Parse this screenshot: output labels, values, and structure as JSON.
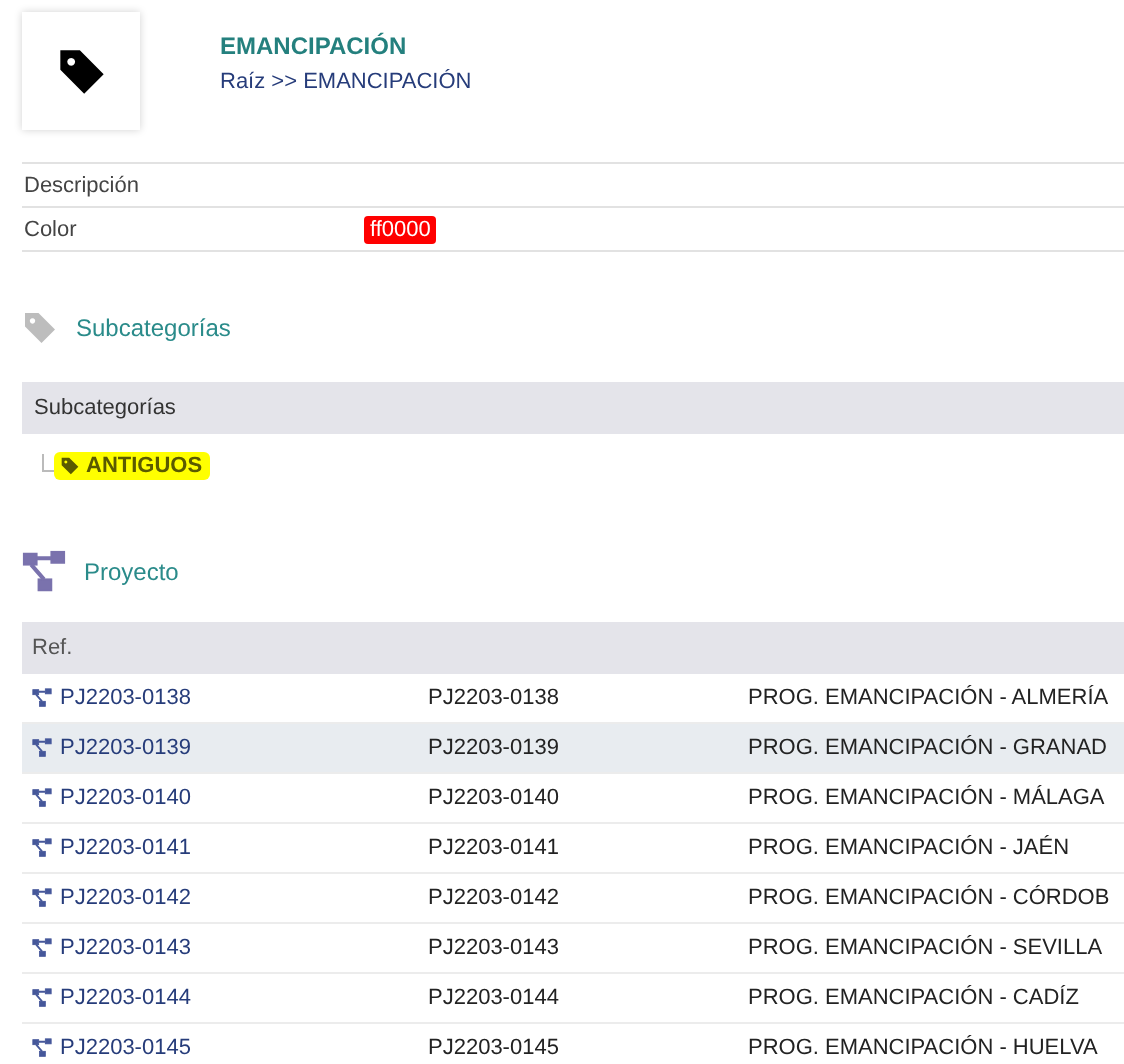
{
  "header": {
    "title": "EMANCIPACIÓN",
    "breadcrumb": "Raíz >> EMANCIPACIÓN"
  },
  "fields": [
    {
      "label": "Descripción"
    },
    {
      "label": "Color",
      "badge": "ff0000",
      "color": "#ff0000"
    }
  ],
  "subcategories": {
    "title": "Subcategorías",
    "column": "Subcategorías",
    "items": [
      {
        "label": "ANTIGUOS",
        "color": "#ffff00"
      }
    ]
  },
  "projects": {
    "title": "Proyecto",
    "columns": [
      "Ref."
    ],
    "rows": [
      {
        "ref": "PJ2203-0138",
        "code": "PJ2203-0138",
        "name": "PROG. EMANCIPACIÓN - ALMERÍA",
        "selected": false
      },
      {
        "ref": "PJ2203-0139",
        "code": "PJ2203-0139",
        "name": "PROG. EMANCIPACIÓN - GRANAD",
        "selected": true
      },
      {
        "ref": "PJ2203-0140",
        "code": "PJ2203-0140",
        "name": "PROG. EMANCIPACIÓN - MÁLAGA",
        "selected": false
      },
      {
        "ref": "PJ2203-0141",
        "code": "PJ2203-0141",
        "name": "PROG. EMANCIPACIÓN - JAÉN",
        "selected": false
      },
      {
        "ref": "PJ2203-0142",
        "code": "PJ2203-0142",
        "name": "PROG. EMANCIPACIÓN - CÓRDOB",
        "selected": false
      },
      {
        "ref": "PJ2203-0143",
        "code": "PJ2203-0143",
        "name": "PROG. EMANCIPACIÓN - SEVILLA",
        "selected": false
      },
      {
        "ref": "PJ2203-0144",
        "code": "PJ2203-0144",
        "name": "PROG. EMANCIPACIÓN - CADÍZ",
        "selected": false
      },
      {
        "ref": "PJ2203-0145",
        "code": "PJ2203-0145",
        "name": "PROG. EMANCIPACIÓN - HUELVA",
        "selected": false
      }
    ]
  }
}
